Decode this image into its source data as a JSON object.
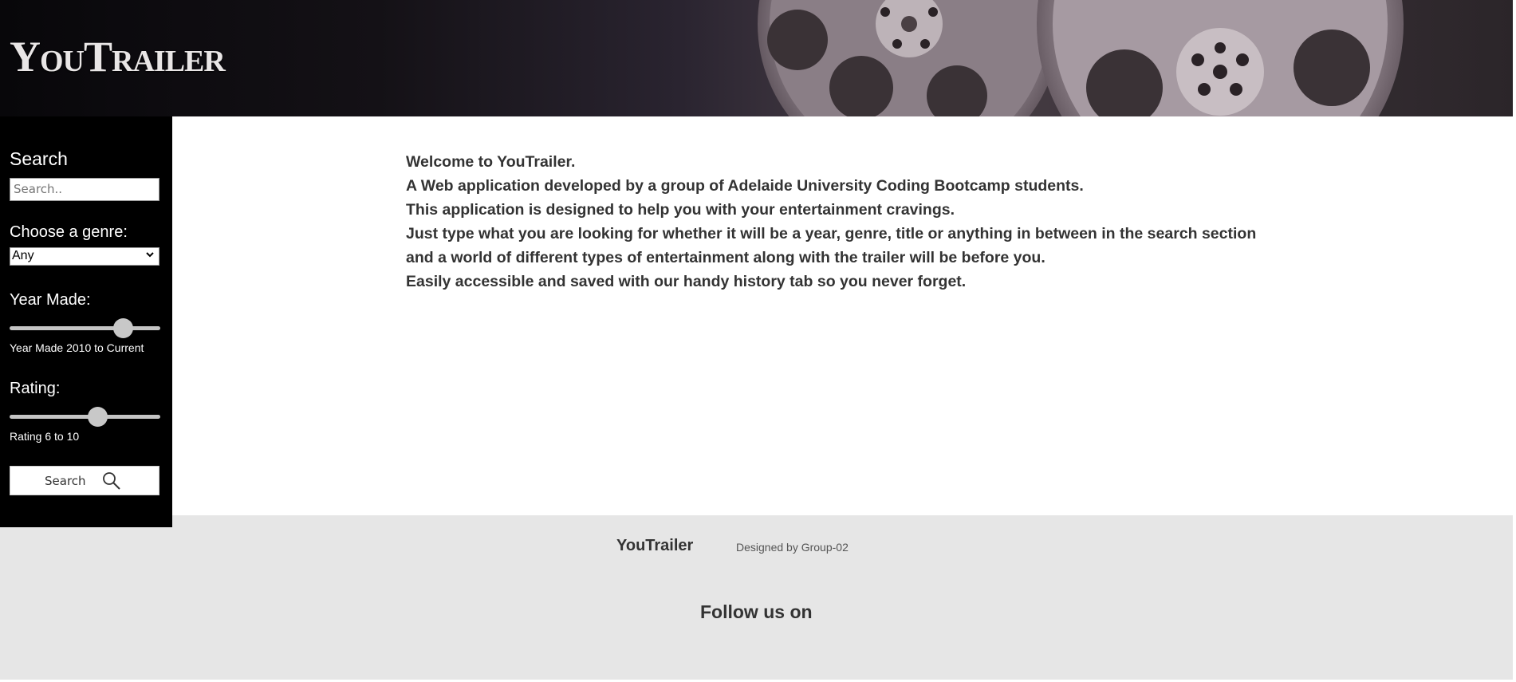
{
  "header": {
    "logo": "YouTrailer"
  },
  "sidebar": {
    "search_title": "Search",
    "search_placeholder": "Search..",
    "genre_label": "Choose a genre:",
    "genre_selected": "Any",
    "year_label": "Year Made:",
    "year_range_text": "Year Made 2010 to Current",
    "year_slider_fraction": 0.79,
    "rating_label": "Rating:",
    "rating_range_text": "Rating 6 to 10",
    "rating_slider_fraction": 0.6,
    "search_button_label": "Search"
  },
  "main": {
    "intro_lines": [
      "Welcome to YouTrailer.",
      "A Web application developed by a group of Adelaide University Coding Bootcamp students.",
      "This application is designed to help you with your entertainment cravings.",
      "Just type what you are looking for whether it will be a year, genre, title or anything in between in the search section",
      "and a world of different types of entertainment along with the trailer will be before you.",
      "Easily accessible and saved with our handy history tab so you never forget."
    ]
  },
  "footer": {
    "brand": "YouTrailer",
    "credit": "Designed by Group-02",
    "follow": "Follow us on"
  },
  "colors": {
    "sidebar_bg": "#000000",
    "footer_bg": "#e6e6e6",
    "text_dark": "#333333"
  }
}
